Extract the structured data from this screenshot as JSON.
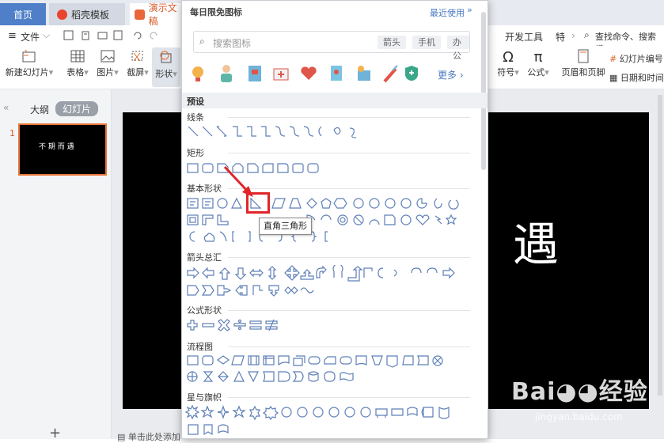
{
  "tabs": [
    {
      "label": "首页"
    },
    {
      "label": "稻壳模板"
    },
    {
      "label": "演示文稿"
    }
  ],
  "menu": {
    "file": "文件",
    "dev_tools": "开发工具",
    "special": "特",
    "search_cmd": "查找命令、搜索模"
  },
  "toolbar": {
    "new_slide": "新建幻灯片",
    "table": "表格",
    "picture": "图片",
    "screenshot": "截屏",
    "shape": "形状",
    "symbol": "符号",
    "formula": "公式",
    "header_footer": "页眉和页脚",
    "slide_number": "幻灯片编号",
    "date_time": "日期和时间"
  },
  "left_panel": {
    "outline_tab": "大纲",
    "slides_tab": "幻灯片",
    "thumb_number": "1",
    "thumb_text": "不 期 而 遇"
  },
  "slide": {
    "big_text": "遇"
  },
  "notes_hint": "单击此处添加",
  "panel": {
    "title": "每日限免图标",
    "recent": "最近使用",
    "search_placeholder": "搜索图标",
    "chips": [
      "箭头",
      "手机",
      "办公"
    ],
    "more": "更多",
    "preset": "预设",
    "sections": {
      "lines": "线条",
      "rect": "矩形",
      "basic": "基本形状",
      "arrows": "箭头总汇",
      "formula": "公式形状",
      "flowchart": "流程图",
      "stars": "星与旗帜"
    },
    "tooltip": "直角三角形",
    "stroke_color": "#5e7fb6",
    "highlight_color": "#e0262a"
  },
  "watermark": {
    "site": "jingyan.baidu.com"
  }
}
